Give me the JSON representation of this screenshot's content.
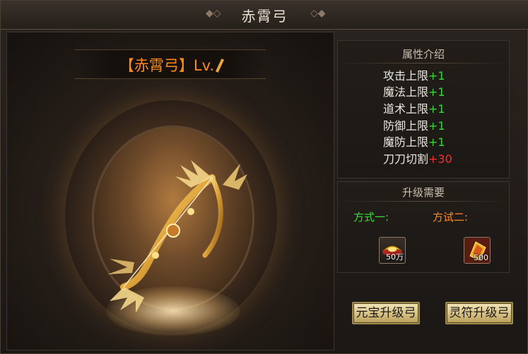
{
  "window": {
    "title": "赤霄弓"
  },
  "item": {
    "name_prefix": "【赤霄弓】Lv.",
    "icon": "bow-icon"
  },
  "attributes": {
    "header": "属性介绍",
    "rows": [
      {
        "label": "攻击上限",
        "value": "+1",
        "color": "#33dd33"
      },
      {
        "label": "魔法上限",
        "value": "+1",
        "color": "#33dd33"
      },
      {
        "label": "道术上限",
        "value": "+1",
        "color": "#33dd33"
      },
      {
        "label": "防御上限",
        "value": "+1",
        "color": "#33dd33"
      },
      {
        "label": "魔防上限",
        "value": "+1",
        "color": "#33dd33"
      },
      {
        "label": "刀刀切割",
        "value": "+30",
        "color": "#ff2a2a"
      }
    ]
  },
  "upgrade": {
    "header": "升级需要",
    "method1": {
      "label": "方式一:",
      "color": "#33dd33",
      "icon": "gold-ingot-icon",
      "count": "50万"
    },
    "method2": {
      "label": "方试二:",
      "color": "#ff8a1c",
      "icon": "talisman-icon",
      "count": "500"
    }
  },
  "buttons": {
    "yuanbao_upgrade": "元宝升级弓",
    "talisman_upgrade": "灵符升级弓"
  }
}
